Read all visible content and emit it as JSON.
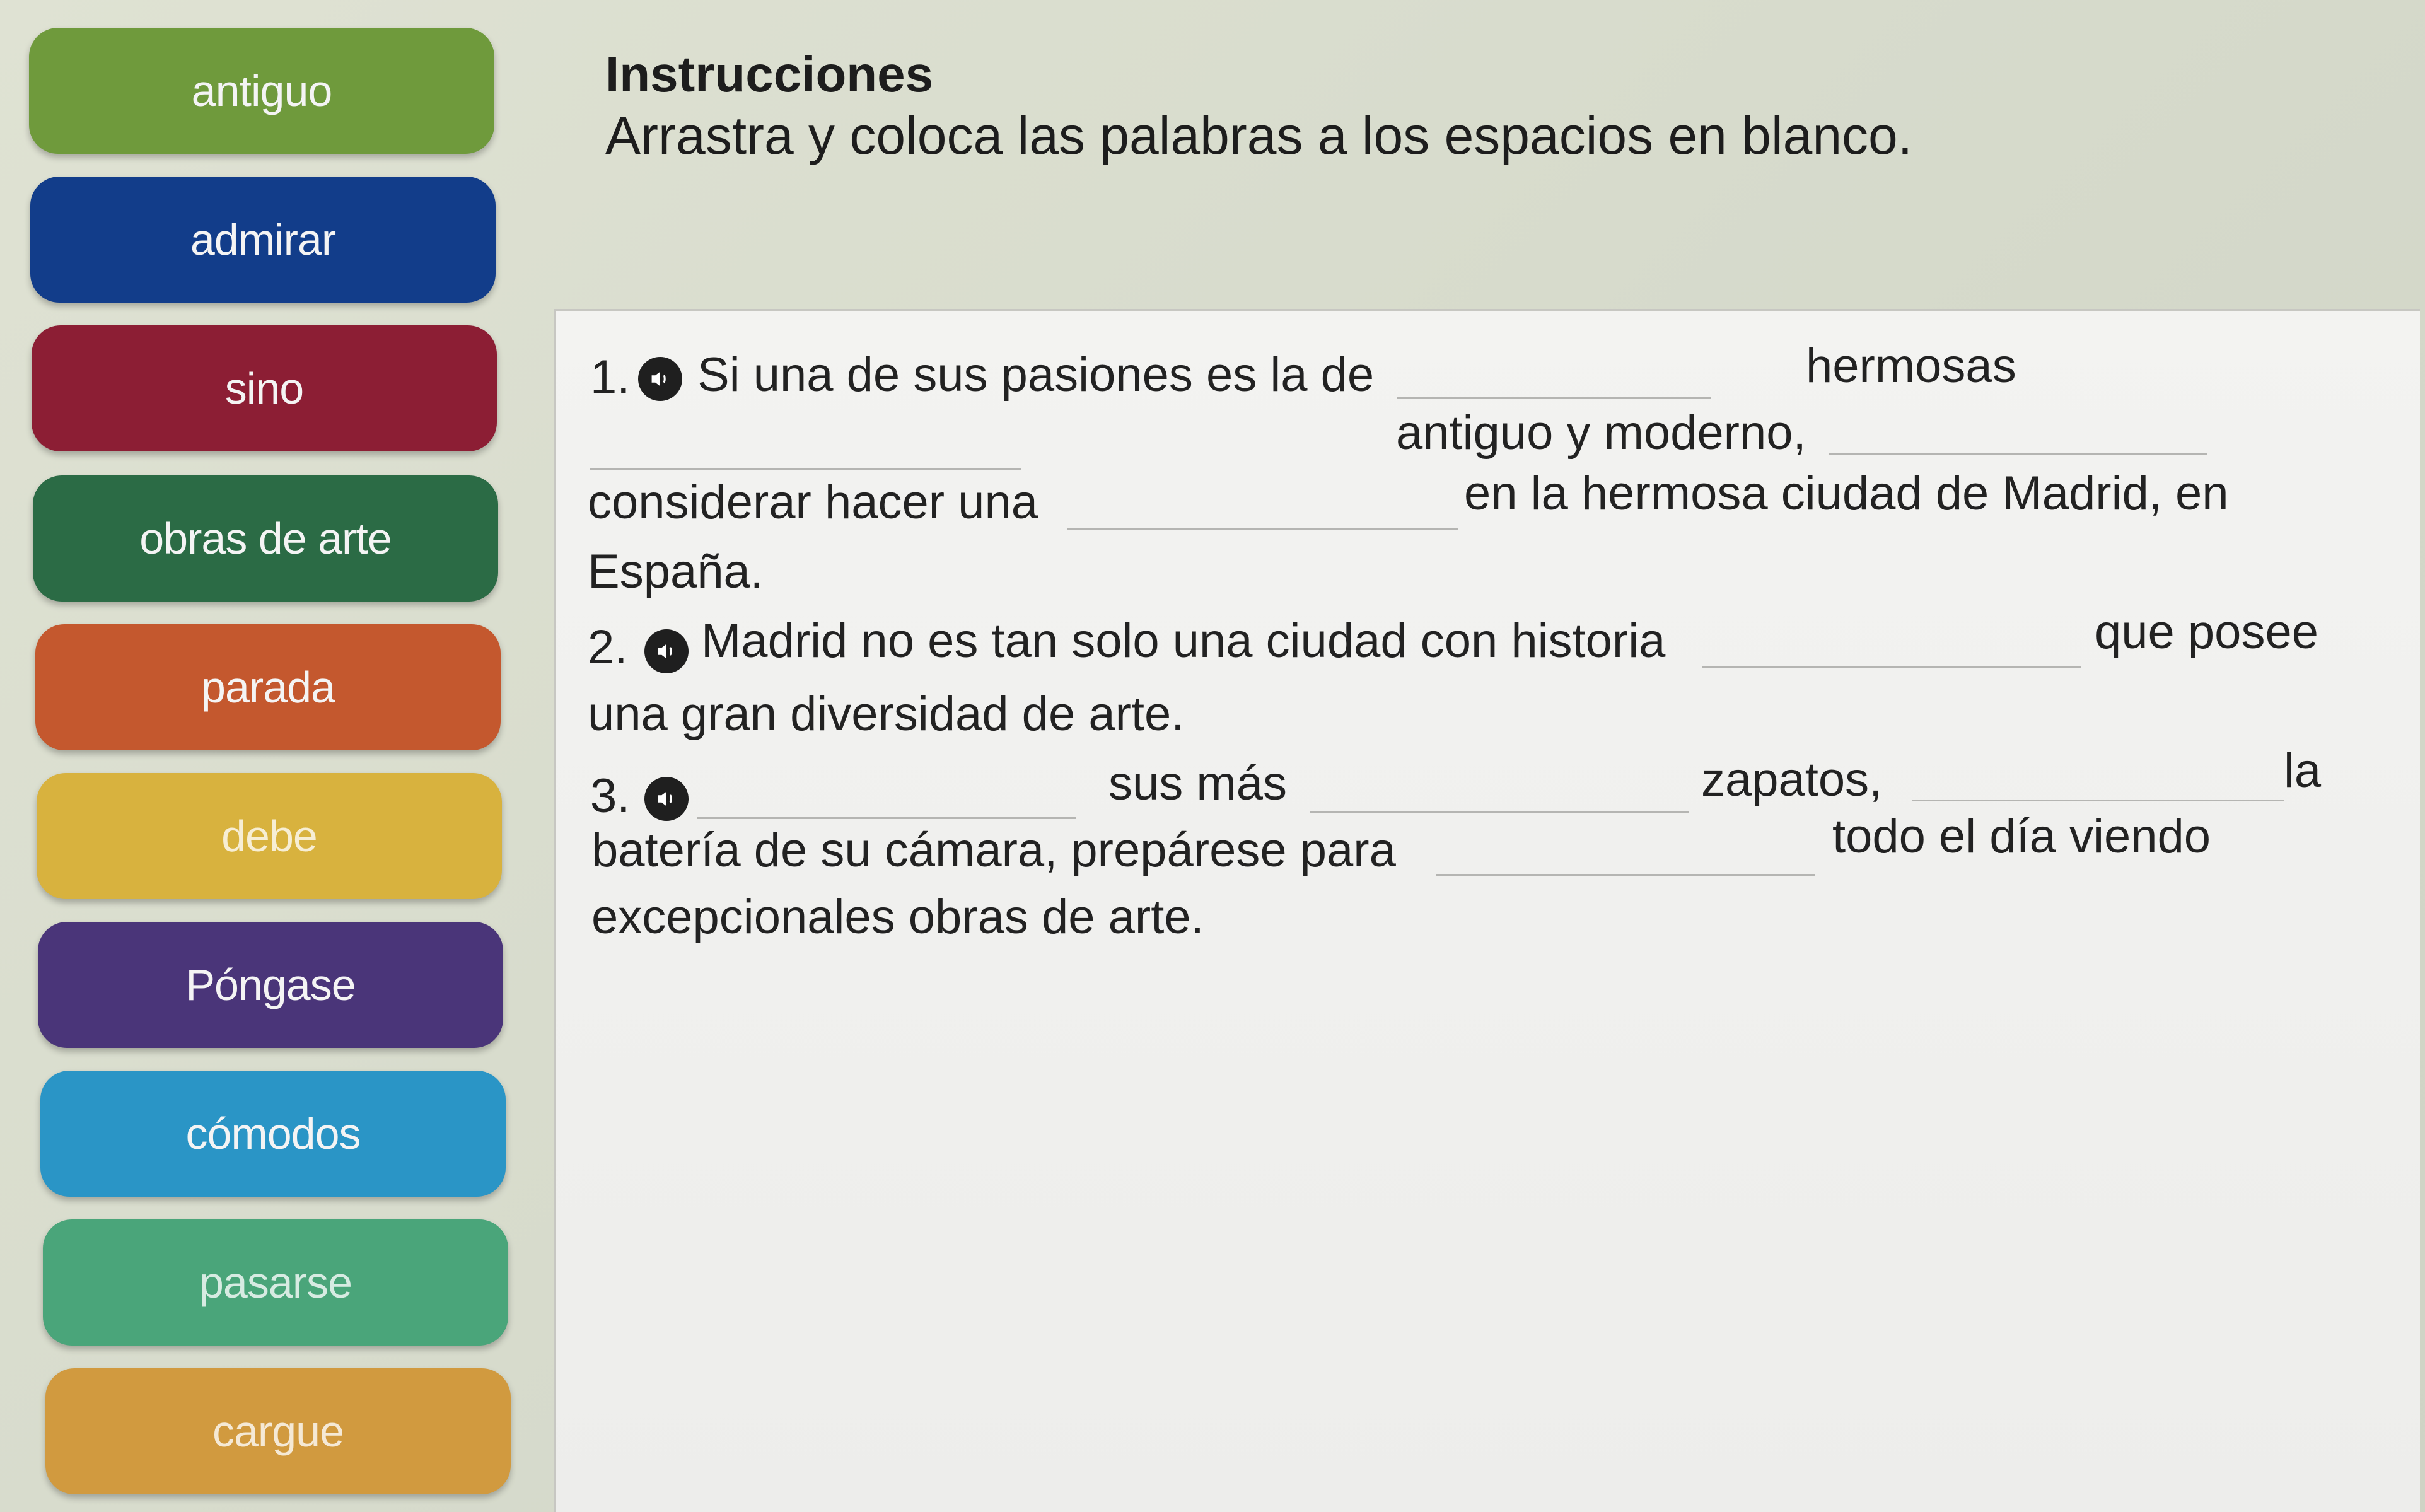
{
  "word_bank": [
    {
      "label": "antiguo",
      "color": "#6f9a3c"
    },
    {
      "label": "admirar",
      "color": "#123d8a"
    },
    {
      "label": "sino",
      "color": "#8c1e34"
    },
    {
      "label": "obras de arte",
      "color": "#2b6b45"
    },
    {
      "label": "parada",
      "color": "#c4582e"
    },
    {
      "label": "debe",
      "color": "#d8b23e"
    },
    {
      "label": "Póngase",
      "color": "#4a3579"
    },
    {
      "label": "cómodos",
      "color": "#2a95c6"
    },
    {
      "label": "pasarse",
      "color": "#4aa57a"
    },
    {
      "label": "cargue",
      "color": "#d19a3f"
    }
  ],
  "instructions": {
    "title": "Instrucciones",
    "text": "Arrastra y coloca las palabras a los espacios en blanco."
  },
  "questions": {
    "q1": {
      "number": "1.",
      "audio_icon": "speaker-icon",
      "seg1": "Si una de sus pasiones es la de",
      "seg2": "hermosas",
      "seg3": "antiguo y moderno,",
      "seg4": "considerar hacer una",
      "seg5": "en la hermosa ciudad de Madrid, en",
      "seg6": "España."
    },
    "q2": {
      "number": "2.",
      "audio_icon": "speaker-icon",
      "seg1": "Madrid no es tan solo una ciudad con historia",
      "seg2": "que posee",
      "seg3": "una gran diversidad de arte."
    },
    "q3": {
      "number": "3.",
      "audio_icon": "speaker-icon",
      "seg1": "sus más",
      "seg2": "zapatos,",
      "seg3": "la",
      "seg4": "batería de su cámara, prepárese para",
      "seg5": "todo el día viendo",
      "seg6": "excepcionales obras de arte."
    }
  },
  "colors": {
    "panel_background": "#f0f0ee",
    "page_background": "#d8dccd",
    "blank_line": "#b5b5b2"
  }
}
